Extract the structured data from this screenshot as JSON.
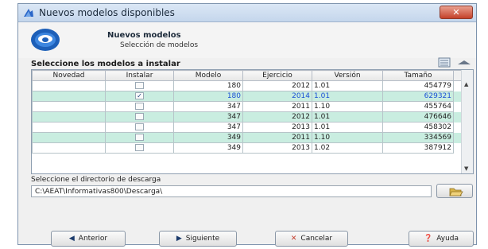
{
  "window": {
    "title": "Nuevos modelos disponibles",
    "close_label": "✕"
  },
  "header": {
    "title": "Nuevos modelos",
    "subtitle": "Selección de modelos"
  },
  "models": {
    "section_label": "Seleccione los modelos a instalar",
    "columns": [
      "Novedad",
      "Instalar",
      "Modelo",
      "Ejercicio",
      "Versión",
      "Tamaño"
    ],
    "rows": [
      {
        "novedad": "",
        "instalar": false,
        "modelo": "180",
        "ejercicio": "2012",
        "version": "1.01",
        "tamano": "454779"
      },
      {
        "novedad": "",
        "instalar": true,
        "modelo": "180",
        "ejercicio": "2014",
        "version": "1.01",
        "tamano": "629321"
      },
      {
        "novedad": "",
        "instalar": false,
        "modelo": "347",
        "ejercicio": "2011",
        "version": "1.10",
        "tamano": "455764"
      },
      {
        "novedad": "",
        "instalar": false,
        "modelo": "347",
        "ejercicio": "2012",
        "version": "1.01",
        "tamano": "476646"
      },
      {
        "novedad": "",
        "instalar": false,
        "modelo": "347",
        "ejercicio": "2013",
        "version": "1.01",
        "tamano": "458302"
      },
      {
        "novedad": "",
        "instalar": false,
        "modelo": "349",
        "ejercicio": "2011",
        "version": "1.10",
        "tamano": "334569"
      },
      {
        "novedad": "",
        "instalar": false,
        "modelo": "349",
        "ejercicio": "2013",
        "version": "1.02",
        "tamano": "387912"
      }
    ],
    "selected_row": 1,
    "highlighted_rows": [
      1,
      3,
      5
    ]
  },
  "download": {
    "label": "Seleccione el directorio de descarga",
    "path": "C:\\AEAT\\Informativas800\\Descarga\\"
  },
  "buttons": {
    "back": "Anterior",
    "next": "Siguiente",
    "cancel": "Cancelar",
    "help": "Ayuda"
  },
  "colors": {
    "highlight_row": "#c9ede0",
    "selected_text": "#1a4fd6"
  }
}
